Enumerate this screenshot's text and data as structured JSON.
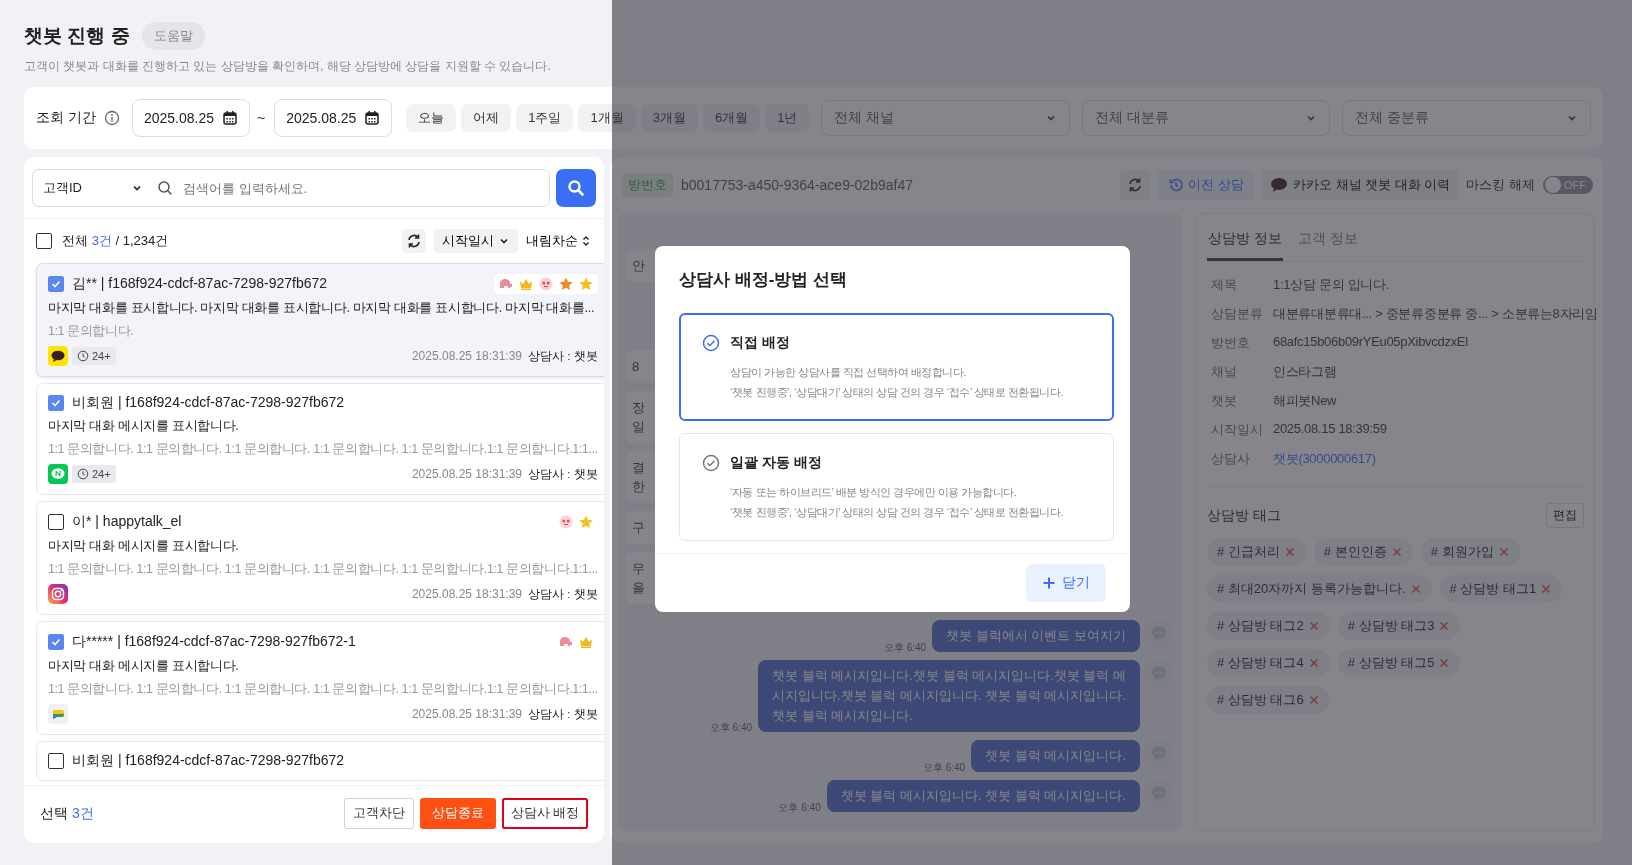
{
  "page": {
    "title": "챗봇 진행 중",
    "help_button": "도움말",
    "description": "고객이 챗봇과 대화를 진행하고 있는 상담방을 확인하며, 해당 상담방에 상담을 지원할 수 있습니다."
  },
  "filter": {
    "label": "조회 기간",
    "start_date": "2025.08.25",
    "separator": "~",
    "end_date": "2025.08.25",
    "periods": [
      {
        "label": "오늘",
        "selected": false
      },
      {
        "label": "어제",
        "selected": false
      },
      {
        "label": "1주일",
        "selected": false
      },
      {
        "label": "1개월",
        "selected": false
      },
      {
        "label": "3개월",
        "selected": false
      },
      {
        "label": "6개월",
        "selected": false
      },
      {
        "label": "1년",
        "selected": false
      }
    ],
    "selects": [
      {
        "value": "전체 채널"
      },
      {
        "value": "전체 대분류"
      },
      {
        "value": "전체 중분류"
      }
    ]
  },
  "list": {
    "search_type": "고객ID",
    "search_placeholder": "검색어를 입력하세요.",
    "select_all_checked": false,
    "total_label": "전체",
    "selected_count": "3건",
    "total_count": "/ 1,234건",
    "sort_field": "시작일시",
    "sort_order": "내림차순",
    "items": [
      {
        "selected": true,
        "checked": true,
        "title": "김** | f168f924-cdcf-87ac-7298-927fb672",
        "markers": [
          {
            "kind": "elephant"
          },
          {
            "kind": "crown"
          },
          {
            "kind": "face"
          },
          {
            "kind": "star-orange"
          },
          {
            "kind": "star"
          }
        ],
        "message": "마지막 대화를 표시합니다.  마지막 대화를 표시합니다. 마지막 대화를 표시합니다. 마지막 대화를...",
        "preview": "1:1 문의합니다.",
        "channel_icon": {
          "kind": "kakao"
        },
        "wait": "24+",
        "time": "2025.08.25 18:31:39",
        "agent": "상담사 : 챗봇"
      },
      {
        "selected": false,
        "checked": true,
        "title": "비회원 | f168f924-cdcf-87ac-7298-927fb672",
        "message": "마지막 대화 메시지를 표시합니다.",
        "preview": "1:1 문의합니다. 1:1 문의합니다. 1:1 문의합니다. 1:1 문의합니다. 1:1 문의합니다.1:1 문의합니다.1:1...",
        "channel_icon": {
          "kind": "line"
        },
        "wait": "24+",
        "time": "2025.08.25 18:31:39",
        "agent": "상담사 : 챗봇"
      },
      {
        "selected": false,
        "checked": false,
        "title": "이* | happytalk_el",
        "markers": [
          {
            "kind": "face"
          },
          {
            "kind": "star"
          }
        ],
        "message": "마지막 대화 메시지를 표시합니다.",
        "preview": "1:1 문의합니다. 1:1 문의합니다. 1:1 문의합니다. 1:1 문의합니다. 1:1 문의합니다.1:1 문의합니다.1:1...",
        "channel_icon": {
          "kind": "instagram"
        },
        "time": "2025.08.25 18:31:39",
        "agent": "상담사 : 챗봇"
      },
      {
        "selected": false,
        "checked": true,
        "title": "다***** | f168f924-cdcf-87ac-7298-927fb672-1",
        "markers": [
          {
            "kind": "elephant"
          },
          {
            "kind": "crown"
          }
        ],
        "message": "마지막 대화 메시지를 표시합니다.",
        "preview": "1:1 문의합니다. 1:1 문의합니다. 1:1 문의합니다. 1:1 문의합니다. 1:1 문의합니다.1:1 문의합니다.1:1...",
        "channel_icon": {
          "kind": "chat"
        },
        "time": "2025.08.25 18:31:39",
        "agent": "상담사 : 챗봇"
      },
      {
        "selected": false,
        "checked": false,
        "title": "비회원 | f168f924-cdcf-87ac-7298-927fb672"
      }
    ],
    "footer": {
      "label": "선택",
      "count": "3건",
      "buttons": [
        {
          "label": "고객차단",
          "kind": "outline",
          "highlighted": false
        },
        {
          "label": "상담종료",
          "kind": "danger",
          "highlighted": false
        },
        {
          "label": "상담사 배정",
          "kind": "outline",
          "highlighted": true
        }
      ]
    }
  },
  "room": {
    "id_label": "방번호",
    "id": "b0017753-a450-9364-ace9-02b9af47",
    "history_button": "이전 상담",
    "kakao_button": "카카오 채널 챗봇 대화 이력",
    "masking_label": "마스킹 해제",
    "masking_on": false,
    "masking_text": "OFF"
  },
  "chat": {
    "messages": [
      {
        "kind": "received",
        "lines": [
          "안"
        ]
      },
      {
        "kind": "received",
        "lines": [
          "8"
        ]
      },
      {
        "kind": "received",
        "lines": [
          "장",
          "일"
        ]
      },
      {
        "kind": "received",
        "lines": [
          "결",
          "한"
        ]
      },
      {
        "kind": "received",
        "lines": [
          "구"
        ]
      },
      {
        "kind": "received",
        "lines": [
          "무",
          "을"
        ]
      },
      {
        "kind": "sent",
        "lines": [
          "챗봇 블럭에서 이벤트 보여지기"
        ],
        "time": "오후 6:40"
      },
      {
        "kind": "sent",
        "lines": [
          "챗봇 블럭 메시지입니다.챗봇 블럭 메시지입니다.챗봇 블럭 메",
          "시지입니다.챗봇 블럭 메시지입니다. 챗봇 블럭 메시지입니다.",
          "챗봇 블럭 메시지입니다."
        ],
        "time": "오후 6:40"
      },
      {
        "kind": "sent",
        "lines": [
          "챗봇 블럭 메시지입니다."
        ],
        "time": "오후 6:40"
      },
      {
        "kind": "sent",
        "lines": [
          "챗봇 블럭 메시지입니다. 챗봇 블럭 메시지입니다."
        ],
        "time": "오후 6:40"
      }
    ]
  },
  "info": {
    "tabs": [
      {
        "label": "상담방 정보",
        "selected": true
      },
      {
        "label": "고객 정보",
        "selected": false
      }
    ],
    "fields": [
      {
        "label": "제목",
        "value": "1:1상담 문의 입니다.",
        "kind": "text"
      },
      {
        "label": "상담분류",
        "value": "대분류대분류대... > 중분류중분류 중... > 소분류는8자리임",
        "kind": "text"
      },
      {
        "label": "방번호",
        "value": "68afc15b06b09rYEu05pXibvcdzxEl",
        "kind": "text"
      },
      {
        "label": "채널",
        "value": "인스타그램",
        "kind": "text"
      },
      {
        "label": "챗봇",
        "value": "해피봇New",
        "kind": "text"
      },
      {
        "label": "시작일시",
        "value": "2025.08.15 18:39:59",
        "kind": "text"
      },
      {
        "label": "상담사",
        "value": "챗봇(3000000617)",
        "kind": "link"
      }
    ],
    "tags_title": "상담방 태그",
    "edit_button": "편집",
    "tags": [
      "# 긴급처리",
      "# 본인인증",
      "# 회원가입",
      "# 최대20자까지 등록가능합니다.",
      "# 상담방 태그1",
      "# 상담방 태그2",
      "# 상담방 태그3",
      "# 상담방 태그4",
      "# 상담방 태그5",
      "# 상담방 태그6"
    ]
  },
  "modal": {
    "title": "상담사 배정-방법 선택",
    "options": [
      {
        "title": "직접 배정",
        "selected": true,
        "lines": [
          "상담이 가능한 상담사를 직접 선택하여 배정합니다.",
          "‘챗봇 진행중’, ‘상담대기’ 상태의 상담 건의 경우 ‘접수’ 상태로 전환됩니다."
        ]
      },
      {
        "title": "일괄 자동 배정",
        "selected": false,
        "lines": [
          "‘자동 또는 하이브리드’ 배분 방식인 경우에만 이용 가능합니다.",
          "‘챗봇 진행중’, ‘상담대기’ 상태의 상담 건의 경우 ‘접수’ 상태로 전환됩니다."
        ]
      }
    ],
    "close_button": "닫기"
  }
}
